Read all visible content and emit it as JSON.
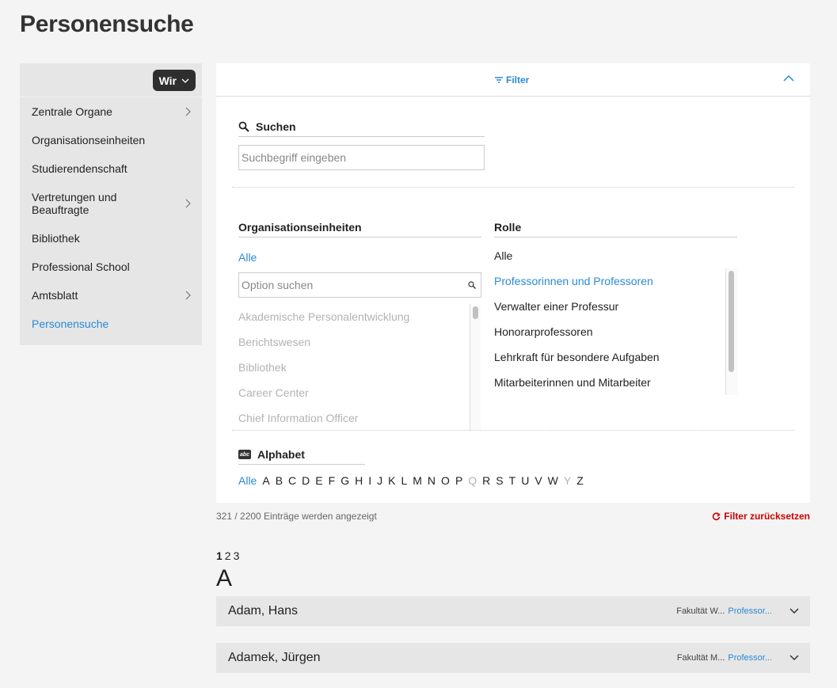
{
  "page": {
    "title": "Personensuche"
  },
  "sidebar": {
    "menu_button": "Wir",
    "items": [
      {
        "label": "Zentrale Organe",
        "has_children": true
      },
      {
        "label": "Organisationseinheiten",
        "has_children": false
      },
      {
        "label": "Studierendenschaft",
        "has_children": false
      },
      {
        "label": "Vertretungen und Beauftragte",
        "has_children": true
      },
      {
        "label": "Bibliothek",
        "has_children": false
      },
      {
        "label": "Professional School",
        "has_children": false
      },
      {
        "label": "Amtsblatt",
        "has_children": true
      },
      {
        "label": "Personensuche",
        "has_children": false,
        "active": true
      }
    ]
  },
  "filter": {
    "toggle_label": "Filter",
    "search": {
      "label": "Suchen",
      "placeholder": "Suchbegriff eingeben"
    },
    "org": {
      "label": "Organisationseinheiten",
      "all_label": "Alle",
      "option_placeholder": "Option suchen",
      "options": [
        "Akademische Personalentwicklung",
        "Berichtswesen",
        "Bibliothek",
        "Career Center",
        "Chief Information Officer"
      ]
    },
    "role": {
      "label": "Rolle",
      "options": [
        "Alle",
        "Professorinnen und Professoren",
        "Verwalter einer Professur",
        "Honorarprofessoren",
        "Lehrkraft für besondere Aufgaben",
        "Mitarbeiterinnen und Mitarbeiter"
      ],
      "selected": "Professorinnen und Professoren"
    },
    "alphabet": {
      "label": "Alphabet",
      "icon_text": "abc",
      "all_label": "Alle",
      "letters": [
        "A",
        "B",
        "C",
        "D",
        "E",
        "F",
        "G",
        "H",
        "I",
        "J",
        "K",
        "L",
        "M",
        "N",
        "O",
        "P",
        "Q",
        "R",
        "S",
        "T",
        "U",
        "V",
        "W",
        "Y",
        "Z"
      ],
      "disabled": [
        "Q",
        "Y"
      ]
    }
  },
  "results": {
    "count_text": "321 / 2200 Einträge werden angezeigt",
    "reset_label": "Filter zurücksetzen",
    "pages": [
      "1",
      "2",
      "3"
    ],
    "current_page": "1",
    "group_letter": "A",
    "people": [
      {
        "name": "Adam, Hans",
        "unit": "Fakultät W...",
        "role": "Professor..."
      },
      {
        "name": "Adamek, Jürgen",
        "unit": "Fakultät M...",
        "role": "Professor..."
      }
    ]
  },
  "colors": {
    "accent": "#2a8ad4",
    "reset": "#cc0000",
    "sidebar_bg": "#e6e6e6",
    "page_bg": "#f4f4f4"
  },
  "icons": [
    "chevron-down-icon",
    "chevron-right-icon",
    "filter-icon",
    "chevron-up-icon",
    "search-icon",
    "abc-icon",
    "reset-icon"
  ]
}
